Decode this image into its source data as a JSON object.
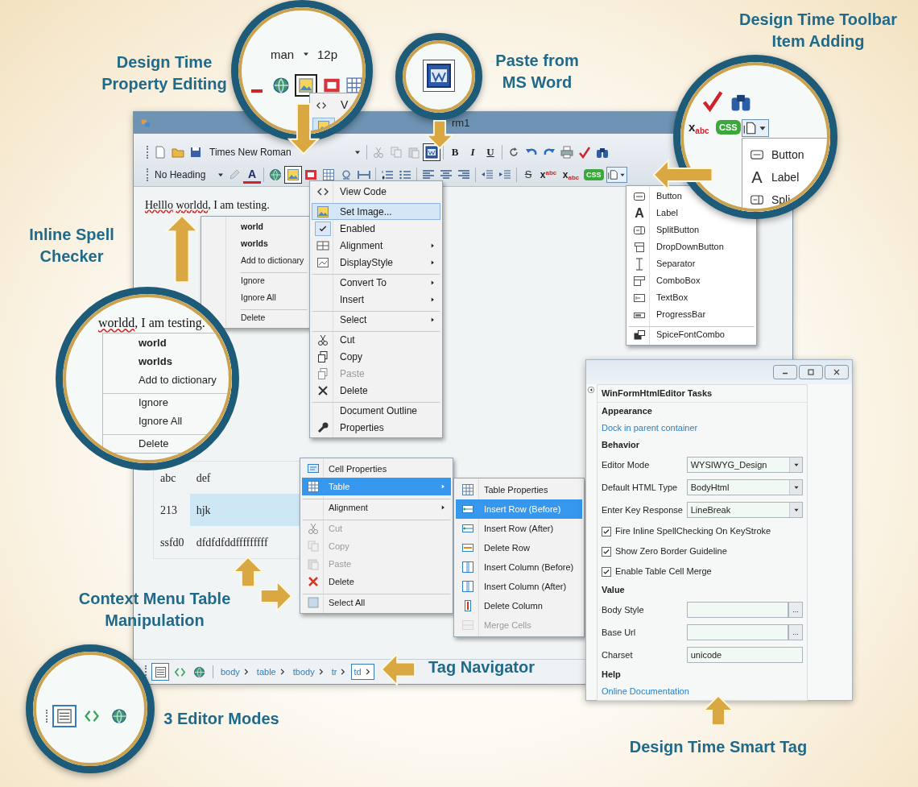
{
  "callouts": [
    {
      "lines": [
        "Design Time",
        "Property Editing"
      ]
    },
    {
      "lines": [
        "Paste from",
        "MS Word"
      ]
    },
    {
      "lines": [
        "Design Time Toolbar",
        "Item Adding"
      ]
    },
    {
      "lines": [
        "Inline Spell",
        "Checker"
      ]
    },
    {
      "lines": [
        "Context Menu Table",
        "Manipulation"
      ]
    },
    {
      "lines": [
        "Tag Navigator"
      ]
    },
    {
      "lines": [
        "3 Editor Modes"
      ]
    },
    {
      "lines": [
        "Design Time Smart Tag"
      ]
    }
  ],
  "property_zoom": {
    "font_fragment": "man",
    "size_fragment": "12p",
    "menu_fragment": "V"
  },
  "toolbar_zoom": {
    "subscript": "x$_{abc}$",
    "css": "CSS",
    "items": [
      {
        "label": "Button",
        "kind": "icon"
      },
      {
        "label": "Label",
        "kind": "glyph",
        "glyph": "A"
      },
      {
        "label": "Spli",
        "kind": "icon"
      }
    ]
  },
  "window": {
    "title": "rm1"
  },
  "toolbar": {
    "font_name": "Times New Roman",
    "bold": "B",
    "italic": "I",
    "underline": "U",
    "heading": "No Heading",
    "font_color": "A",
    "strike": "S",
    "superscript": "x$^{abc}$",
    "subscript": "x$_{abc}$",
    "css": "CSS"
  },
  "editor_text": [
    {
      "text": "Helllo",
      "misspelled": true,
      "space_after": true
    },
    {
      "text": "worldd",
      "misspelled": true,
      "space_after": false
    },
    {
      "text": ", I am testing.",
      "misspelled": false,
      "space_after": false
    }
  ],
  "spell_menu": [
    {
      "label": "world",
      "bold": true,
      "divider_above": false
    },
    {
      "label": "worlds",
      "bold": true,
      "divider_above": false
    },
    {
      "label": "Add to dictionary",
      "bold": false,
      "divider_above": false
    },
    {
      "label": "Ignore",
      "bold": false,
      "divider_above": true
    },
    {
      "label": "Ignore All",
      "bold": false,
      "divider_above": false
    },
    {
      "label": "Delete",
      "bold": false,
      "divider_above": true
    }
  ],
  "spell_zoom": {
    "text": [
      {
        "text": "worldd",
        "misspelled": true,
        "space_after": false
      },
      {
        "text": ", I am testing.",
        "misspelled": false,
        "space_after": false
      }
    ],
    "items": [
      {
        "label": "world",
        "bold": true,
        "divider_above": false
      },
      {
        "label": "worlds",
        "bold": true,
        "divider_above": false
      },
      {
        "label": "Add to dictionary",
        "bold": false,
        "divider_above": false
      },
      {
        "label": "Ignore",
        "bold": false,
        "divider_above": true
      },
      {
        "label": "Ignore All",
        "bold": false,
        "divider_above": false
      },
      {
        "label": "Delete",
        "bold": false,
        "divider_above": true
      }
    ]
  },
  "context_menu": [
    {
      "label": "View Code",
      "selected": false,
      "disabled": false,
      "checked": false,
      "submenu": false,
      "divider_above": false
    },
    {
      "label": "Set Image...",
      "selected": true,
      "disabled": false,
      "checked": false,
      "submenu": false,
      "divider_above": true
    },
    {
      "label": "Enabled",
      "selected": false,
      "disabled": false,
      "checked": true,
      "submenu": false,
      "divider_above": false
    },
    {
      "label": "Alignment",
      "selected": false,
      "disabled": false,
      "checked": false,
      "submenu": true,
      "divider_above": false
    },
    {
      "label": "DisplayStyle",
      "selected": false,
      "disabled": false,
      "checked": false,
      "submenu": true,
      "divider_above": false
    },
    {
      "label": "Convert To",
      "selected": false,
      "disabled": false,
      "checked": false,
      "submenu": true,
      "divider_above": true
    },
    {
      "label": "Insert",
      "selected": false,
      "disabled": false,
      "checked": false,
      "submenu": true,
      "divider_above": false
    },
    {
      "label": "Select",
      "selected": false,
      "disabled": false,
      "checked": false,
      "submenu": true,
      "divider_above": true
    },
    {
      "label": "Cut",
      "selected": false,
      "disabled": false,
      "checked": false,
      "submenu": false,
      "divider_above": true
    },
    {
      "label": "Copy",
      "selected": false,
      "disabled": false,
      "checked": false,
      "submenu": false,
      "divider_above": false
    },
    {
      "label": "Paste",
      "selected": false,
      "disabled": true,
      "checked": false,
      "submenu": false,
      "divider_above": false
    },
    {
      "label": "Delete",
      "selected": false,
      "disabled": false,
      "checked": false,
      "submenu": false,
      "divider_above": false
    },
    {
      "label": "Document Outline",
      "selected": false,
      "disabled": false,
      "checked": false,
      "submenu": false,
      "divider_above": true
    },
    {
      "label": "Properties",
      "selected": false,
      "disabled": false,
      "checked": false,
      "submenu": false,
      "divider_above": false
    }
  ],
  "toolbar_items": [
    {
      "label": "Button",
      "kind": "icon",
      "divider_above": false
    },
    {
      "label": "Label",
      "kind": "glyph",
      "glyph": "A",
      "divider_above": false
    },
    {
      "label": "SplitButton",
      "kind": "icon",
      "divider_above": false
    },
    {
      "label": "DropDownButton",
      "kind": "icon",
      "divider_above": false
    },
    {
      "label": "Separator",
      "kind": "icon",
      "divider_above": false
    },
    {
      "label": "ComboBox",
      "kind": "icon",
      "divider_above": false
    },
    {
      "label": "TextBox",
      "kind": "icon",
      "divider_above": false
    },
    {
      "label": "ProgressBar",
      "kind": "icon",
      "divider_above": false
    },
    {
      "label": "SpiceFontCombo",
      "kind": "icon",
      "divider_above": true
    }
  ],
  "table": {
    "rows": [
      {
        "cells": [
          {
            "text": "abc",
            "selected": false
          },
          {
            "text": "def",
            "selected": false
          }
        ]
      },
      {
        "cells": [
          {
            "text": "213",
            "selected": false
          },
          {
            "text": "hjk",
            "selected": true
          }
        ]
      },
      {
        "cells": [
          {
            "text": "ssfd0",
            "selected": false
          },
          {
            "text": "dfdfdfddfffffffff",
            "selected": false
          }
        ]
      }
    ]
  },
  "table_menu": [
    {
      "label": "Cell Properties",
      "selected": false,
      "disabled": false,
      "submenu": false,
      "divider_above": false
    },
    {
      "label": "Table",
      "selected": true,
      "disabled": false,
      "submenu": true,
      "divider_above": false
    },
    {
      "label": "Alignment",
      "selected": false,
      "disabled": false,
      "submenu": true,
      "divider_above": true
    },
    {
      "label": "Cut",
      "selected": false,
      "disabled": true,
      "submenu": false,
      "divider_above": true
    },
    {
      "label": "Copy",
      "selected": false,
      "disabled": true,
      "submenu": false,
      "divider_above": false
    },
    {
      "label": "Paste",
      "selected": false,
      "disabled": true,
      "submenu": false,
      "divider_above": false
    },
    {
      "label": "Delete",
      "selected": false,
      "disabled": false,
      "submenu": false,
      "divider_above": false
    },
    {
      "label": "Select All",
      "selected": false,
      "disabled": false,
      "submenu": false,
      "divider_above": true
    }
  ],
  "table_submenu": [
    {
      "label": "Table Properties",
      "selected": false,
      "disabled": false,
      "submenu": false,
      "divider_above": false
    },
    {
      "label": "Insert Row (Before)",
      "selected": true,
      "disabled": false,
      "submenu": false,
      "divider_above": false
    },
    {
      "label": "Insert Row (After)",
      "selected": false,
      "disabled": false,
      "submenu": false,
      "divider_above": false
    },
    {
      "label": "Delete Row",
      "selected": false,
      "disabled": false,
      "submenu": false,
      "divider_above": false
    },
    {
      "label": "Insert Column (Before)",
      "selected": false,
      "disabled": false,
      "submenu": false,
      "divider_above": false
    },
    {
      "label": "Insert Column (After)",
      "selected": false,
      "disabled": false,
      "submenu": false,
      "divider_above": false
    },
    {
      "label": "Delete Column",
      "selected": false,
      "disabled": false,
      "submenu": false,
      "divider_above": false
    },
    {
      "label": "Merge Cells",
      "selected": false,
      "disabled": true,
      "submenu": false,
      "divider_above": false
    }
  ],
  "tag_navigator": {
    "modes": [
      {
        "selected": true
      },
      {
        "selected": false
      },
      {
        "selected": false
      }
    ],
    "tags": [
      {
        "label": "body",
        "selected": false
      },
      {
        "label": "table",
        "selected": false
      },
      {
        "label": "tbody",
        "selected": false
      },
      {
        "label": "tr",
        "selected": false
      },
      {
        "label": "td",
        "selected": true
      }
    ]
  },
  "modes_zoom": [
    {
      "selected": true
    },
    {
      "selected": false
    },
    {
      "selected": false
    }
  ],
  "smart_tag": {
    "title": "WinFormHtmlEditor Tasks",
    "rows": [
      {
        "kind": "heading",
        "label": "Appearance"
      },
      {
        "kind": "link",
        "label": "Dock in parent container"
      },
      {
        "kind": "heading",
        "label": "Behavior"
      },
      {
        "kind": "dropdown",
        "label": "Editor Mode",
        "value": "WYSIWYG_Design"
      },
      {
        "kind": "dropdown",
        "label": "Default HTML Type",
        "value": "BodyHtml"
      },
      {
        "kind": "dropdown",
        "label": "Enter Key Response",
        "value": "LineBreak"
      },
      {
        "kind": "checkbox",
        "label": "Fire Inline SpellChecking On KeyStroke",
        "checked": true
      },
      {
        "kind": "checkbox",
        "label": "Show Zero Border Guideline",
        "checked": true
      },
      {
        "kind": "checkbox",
        "label": "Enable Table Cell Merge",
        "checked": true
      },
      {
        "kind": "heading",
        "label": "Value"
      },
      {
        "kind": "browse",
        "label": "Body Style",
        "button": "..."
      },
      {
        "kind": "browse",
        "label": "Base Url",
        "button": "..."
      },
      {
        "kind": "text",
        "label": "Charset",
        "value": "unicode"
      },
      {
        "kind": "heading",
        "label": "Help"
      },
      {
        "kind": "link",
        "label": "Online Documentation"
      }
    ]
  }
}
